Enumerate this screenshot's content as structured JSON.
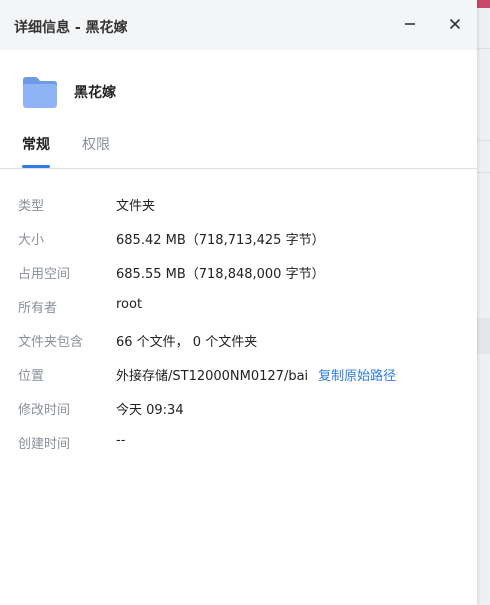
{
  "window": {
    "title": "详细信息 - 黑花嫁",
    "minimize_icon": "minimize-icon",
    "close_icon": "close-icon"
  },
  "item": {
    "icon": "folder-icon",
    "name": "黑花嫁",
    "icon_color": "#8fb4f5"
  },
  "tabs": [
    {
      "label": "常规",
      "active": true
    },
    {
      "label": "权限",
      "active": false
    }
  ],
  "details": [
    {
      "label": "类型",
      "value": "文件夹"
    },
    {
      "label": "大小",
      "value": "685.42 MB（718,713,425 字节）"
    },
    {
      "label": "占用空间",
      "value": "685.55 MB（718,848,000 字节）"
    },
    {
      "label": "所有者",
      "value": "root"
    },
    {
      "label": "文件夹包含",
      "value": "66 个文件， 0 个文件夹"
    },
    {
      "label": "位置",
      "value": "外接存储/ST12000NM0127/bai",
      "link": "复制原始路径"
    },
    {
      "label": "修改时间",
      "value": "今天 09:34"
    },
    {
      "label": "创建时间",
      "value": "--"
    }
  ],
  "colors": {
    "accent": "#2f7de1",
    "label_gray": "#8a9099",
    "titlebar_bg": "#f4f5f7"
  }
}
